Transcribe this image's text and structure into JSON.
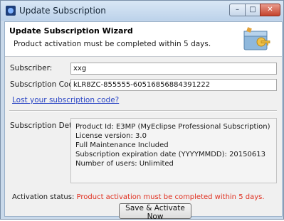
{
  "window": {
    "title": "Update Subscription"
  },
  "header": {
    "title": "Update Subscription Wizard",
    "message": "Product activation must be completed within 5 days."
  },
  "form": {
    "subscriber_label": "Subscriber:",
    "subscriber_value": "xxg",
    "code_label": "Subscription Code:",
    "code_value": "kLR8ZC-855555-60516856884391222",
    "lost_code_link": "Lost your subscription code?",
    "detail_label": "Subscription Detail",
    "details": [
      "Product Id: E3MP (MyEclipse Professional Subscription)",
      "License version: 3.0",
      "Full Maintenance Included",
      "Subscription expiration date (YYYYMMDD): 20150613",
      "Number of users: Unlimited"
    ],
    "status_label": "Activation status:",
    "status_value": "Product activation must be completed within 5 days.",
    "activate_button": "Save & Activate Now"
  },
  "colors": {
    "status_text": "#e03020",
    "link": "#2b46c4"
  },
  "icons": {
    "app": "myeclipse-app-icon",
    "header_logo": "license-key-box-icon"
  }
}
